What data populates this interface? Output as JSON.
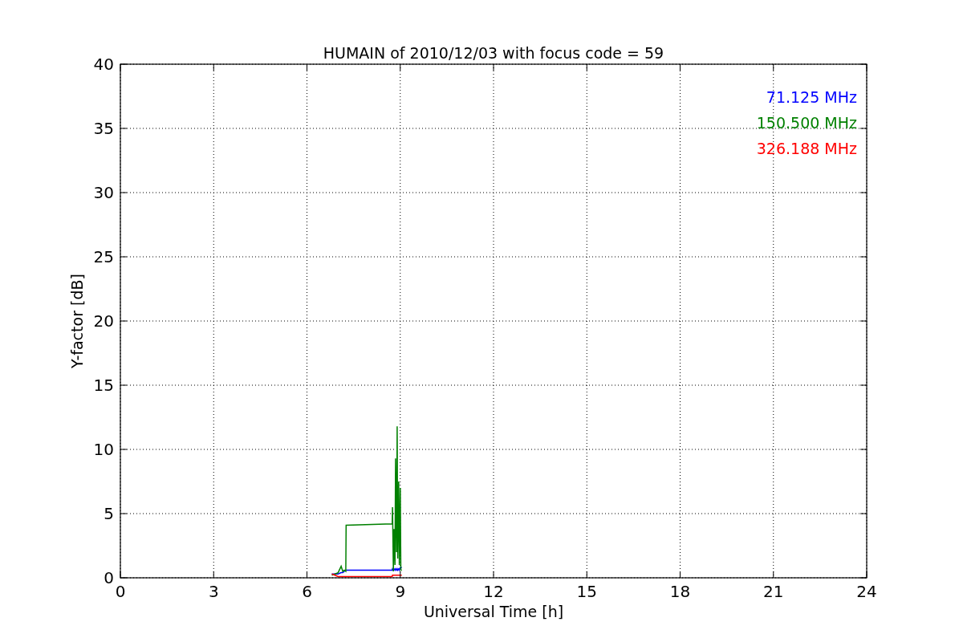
{
  "figure": {
    "chart_data": {
      "type": "line",
      "title": "HUMAIN of 2010/12/03 with focus code = 59",
      "xlabel": "Universal Time [h]",
      "ylabel": "Y-factor [dB]",
      "grid": true,
      "xlim": [
        0,
        24
      ],
      "ylim": [
        0,
        40
      ],
      "xticks": [
        0,
        3,
        6,
        9,
        12,
        15,
        18,
        21,
        24
      ],
      "yticks": [
        0,
        5,
        10,
        15,
        20,
        25,
        30,
        35,
        40
      ],
      "x": [
        6.8,
        6.9,
        7.0,
        7.1,
        7.15,
        7.2,
        7.25,
        7.26,
        8.74,
        8.75,
        8.78,
        8.8,
        8.83,
        8.85,
        8.88,
        8.9,
        8.92,
        8.95,
        8.97,
        9.0,
        9.02,
        9.05
      ],
      "series": [
        {
          "name": "71.125 MHz",
          "color": "#0000ff",
          "values": [
            0.3,
            0.3,
            0.3,
            0.4,
            0.4,
            0.5,
            0.6,
            0.6,
            0.6,
            0.7,
            0.6,
            0.7,
            0.6,
            0.7,
            0.6,
            0.7,
            0.6,
            0.7,
            0.6,
            0.8,
            0.8,
            0.8
          ]
        },
        {
          "name": "150.500 MHz",
          "color": "#008000",
          "values": [
            0.2,
            0.3,
            0.4,
            0.9,
            0.5,
            0.6,
            0.5,
            4.1,
            4.2,
            5.5,
            0.5,
            3.8,
            1.0,
            9.3,
            2.0,
            11.8,
            1.5,
            7.5,
            1.0,
            7.0,
            0.6,
            0.6
          ]
        },
        {
          "name": "326.188 MHz",
          "color": "#ff0000",
          "values": [
            0.3,
            0.2,
            0.1,
            0.1,
            0.1,
            0.1,
            0.1,
            0.1,
            0.1,
            0.2,
            0.2,
            0.2,
            0.2,
            0.2,
            0.2,
            0.2,
            0.2,
            0.2,
            0.2,
            0.2,
            0.2,
            0.2
          ]
        }
      ]
    }
  }
}
